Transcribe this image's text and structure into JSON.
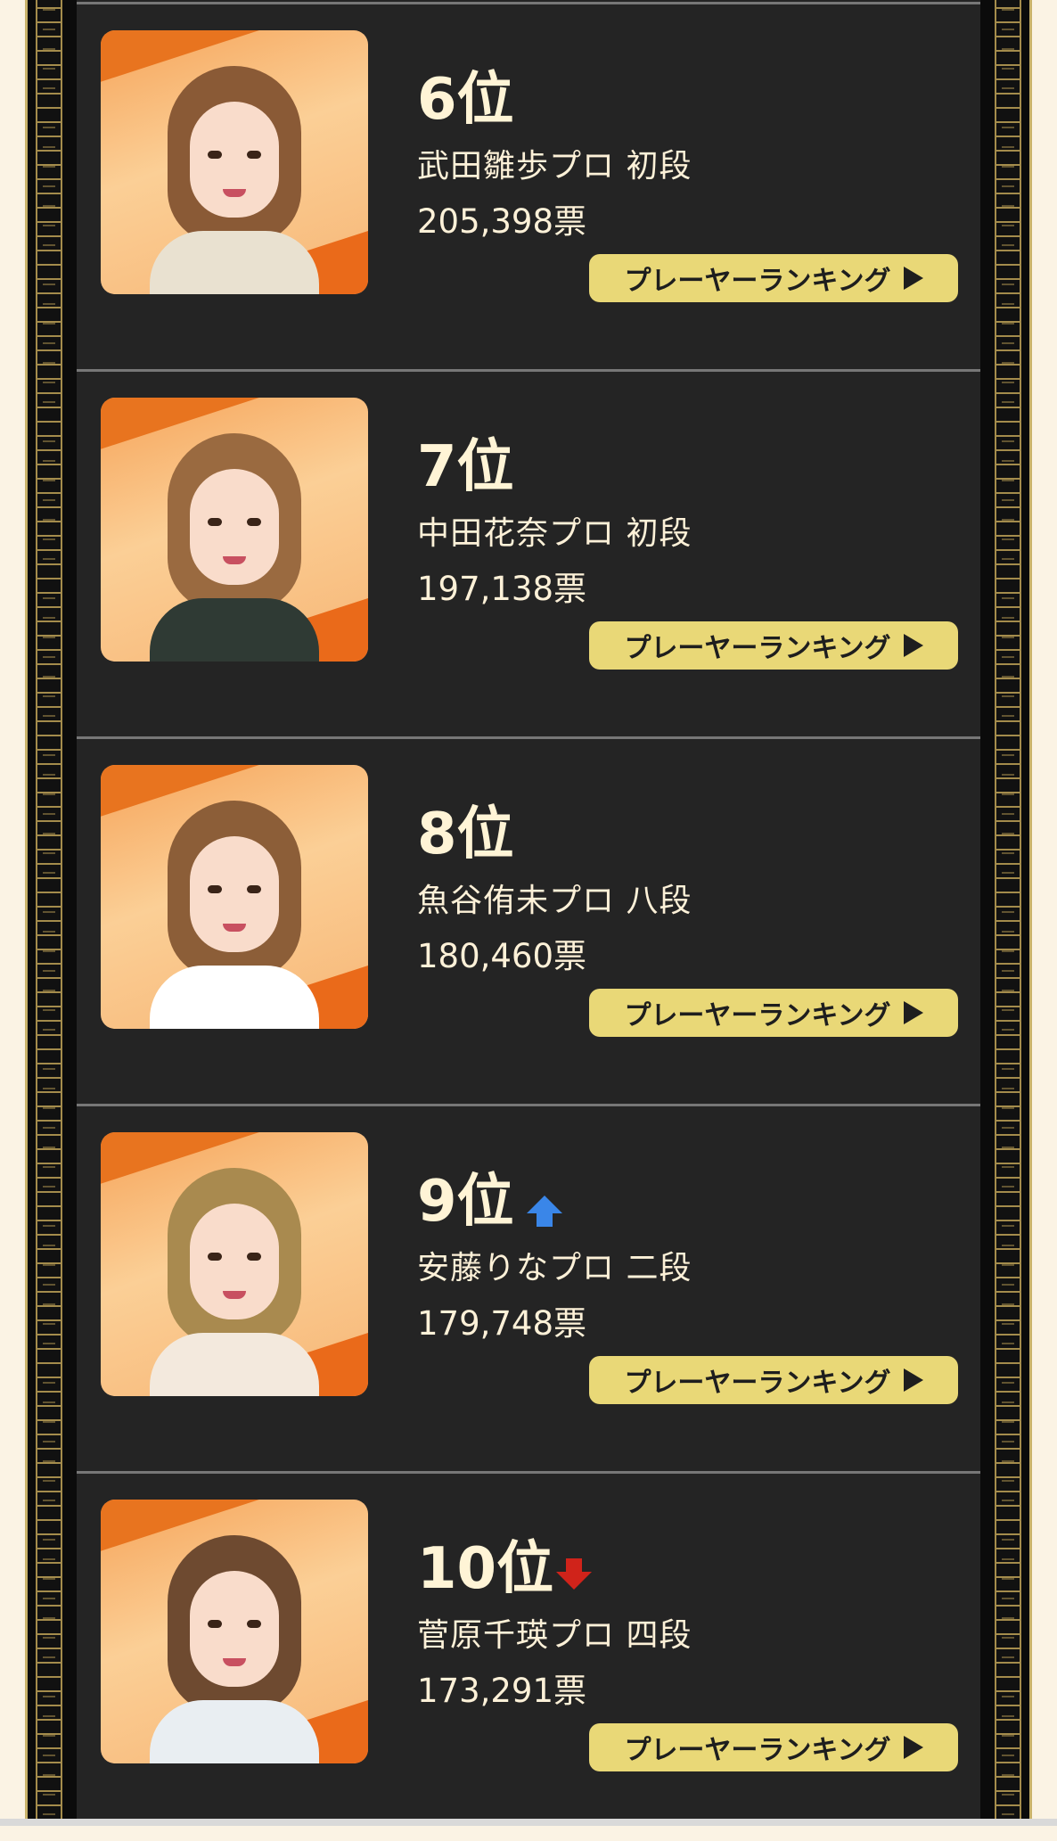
{
  "entries": [
    {
      "rank": "6位",
      "name": "武田雛歩プロ 初段",
      "votes": "205,398票",
      "button": "プレーヤーランキング",
      "change": "none",
      "colors": {
        "body": "#e9e1d0",
        "hair": "#8a5a36"
      }
    },
    {
      "rank": "7位",
      "name": "中田花奈プロ 初段",
      "votes": "197,138票",
      "button": "プレーヤーランキング",
      "change": "none",
      "colors": {
        "body": "#2f3a34",
        "hair": "#9a6a40"
      }
    },
    {
      "rank": "8位",
      "name": "魚谷侑未プロ 八段",
      "votes": "180,460票",
      "button": "プレーヤーランキング",
      "change": "none",
      "colors": {
        "body": "#ffffff",
        "hair": "#8c5e38"
      }
    },
    {
      "rank": "9位",
      "name": "安藤りなプロ 二段",
      "votes": "179,748票",
      "button": "プレーヤーランキング",
      "change": "up",
      "colors": {
        "body": "#f3e9dd",
        "hair": "#a98a4f"
      }
    },
    {
      "rank": "10位",
      "name": "菅原千瑛プロ 四段",
      "votes": "173,291票",
      "button": "プレーヤーランキング",
      "change": "down",
      "colors": {
        "body": "#e9eef2",
        "hair": "#6e4a30"
      }
    }
  ],
  "theme": {
    "panel": "#242424",
    "button": "#e9d877",
    "up_arrow": "#3a86e8",
    "down_arrow": "#d0231a"
  }
}
